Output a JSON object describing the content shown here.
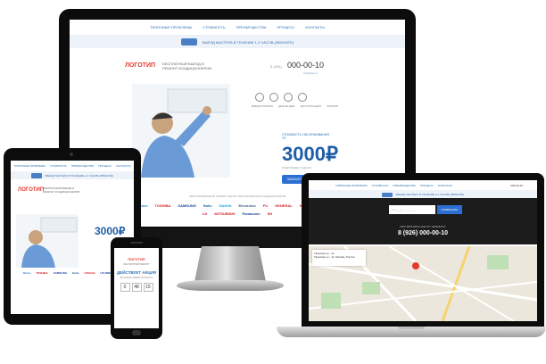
{
  "site": {
    "nav": [
      "ТИПИЧНЫЕ ПРОБЛЕМЫ",
      "СТОИМОСТЬ",
      "ПРЕИМУЩЕСТВА",
      "ПРОЦЕСС",
      "КОНТАКТЫ"
    ],
    "promo_strip": "ВЫЕЗД МАСТЕРА В ТЕЧЕНИЕ 1-2 ЧАСОВ (ЗВОНИТЕ)",
    "logo": "ЛОГОТИП",
    "tagline": "БЕСПЛАТНЫЙ ВЫЕЗД И РЕМОНТ КОНДИЦИОНЕРОВ",
    "phone_code": "8 (926)",
    "phone": "000-00-10",
    "phone_sub": "info@site.ru",
    "features": [
      "ВЫЕЗД ПОЛНОЧЬЮ",
      "ДЕНЬ ВО ДЕНЬ",
      "ДОСТУПНАЯ ЦЕНА",
      "ГАРАНТИЯ"
    ],
    "price_label": "СТОИМОСТЬ ОБСЛУЖИВАНИЯ ОТ",
    "price": "3000₽",
    "price_sub": "ПОДРОБНЕЕ О ЦЕНАХ",
    "cta": "ЗАКАЗАТЬ ЗВОНОК",
    "brands_title": "АВТОРИЗОВАННЫЙ СЕРВИС ЦЕНТР ОБСЛУЖИВАНИЯ КОНДИЦИОНЕРОВ",
    "brands": [
      "Midea",
      "TOSHIBA",
      "SAMSUNG",
      "Ballu",
      "DAIKIN",
      "Electrolux",
      "FU",
      "GENERAL",
      "HITACHI",
      "HYUNDAI",
      "LG",
      "MITSUBISHI",
      "Panasonic",
      "SH"
    ]
  },
  "phone_screen": {
    "logo": "ЛОГОТИП",
    "sub": "БЕСПЛАТНЫЙ РЕМОНТ",
    "action": "ДЕЙСТВУЕТ АКЦИЯ",
    "action_sub": "ДО КОНЦА АКЦИИ ОСТАЛОСЬ",
    "timer": [
      "0",
      "48",
      "15"
    ]
  },
  "laptop_screen": {
    "input_placeholder": "+7 (___) ___-__-__",
    "button": "ПОЗВОНИТЬ",
    "call_label": "ИЛИ ЗВОНИТЕ НАМ ПО ТЕЛЕФОНУ",
    "phone": "8 (926) 000-00-10",
    "address": "Тверская ул., 11",
    "address_sub": "Тверская ул., 11, Москва, Россия"
  },
  "colors": {
    "brand_red": "#e23b2e",
    "brand_blue": "#1f5ea8",
    "button_blue": "#2a6fd1"
  }
}
